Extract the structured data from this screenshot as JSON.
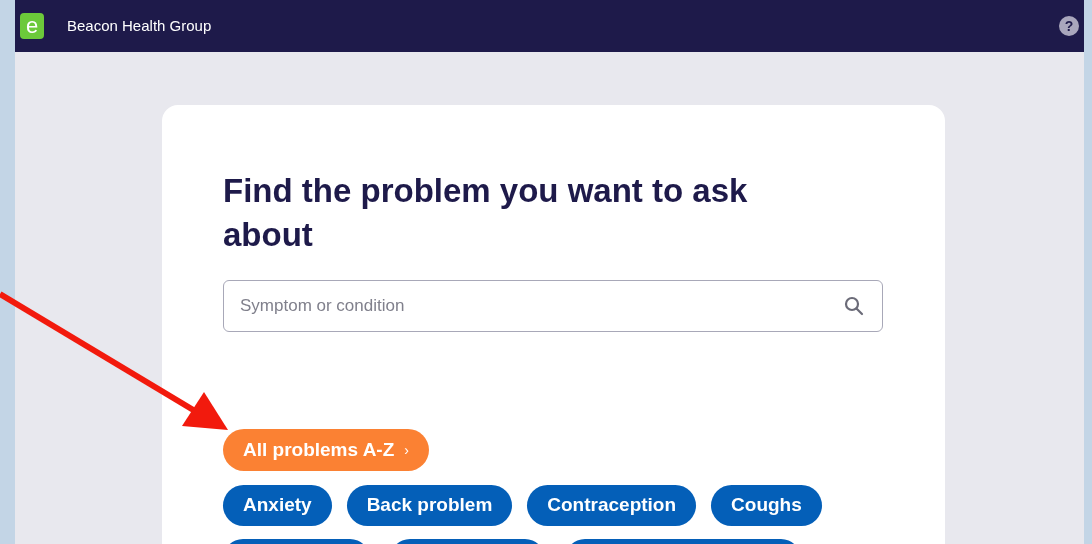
{
  "header": {
    "title": "Beacon Health Group",
    "logo_letter": "e",
    "help": "?"
  },
  "card": {
    "heading": "Find the problem you want to ask about",
    "search": {
      "placeholder": "Symptom or condition"
    },
    "all_problems": {
      "label": "All problems A-Z",
      "chevron": "›"
    },
    "topics": [
      "Anxiety",
      "Back problem",
      "Contraception",
      "Coughs"
    ]
  }
}
